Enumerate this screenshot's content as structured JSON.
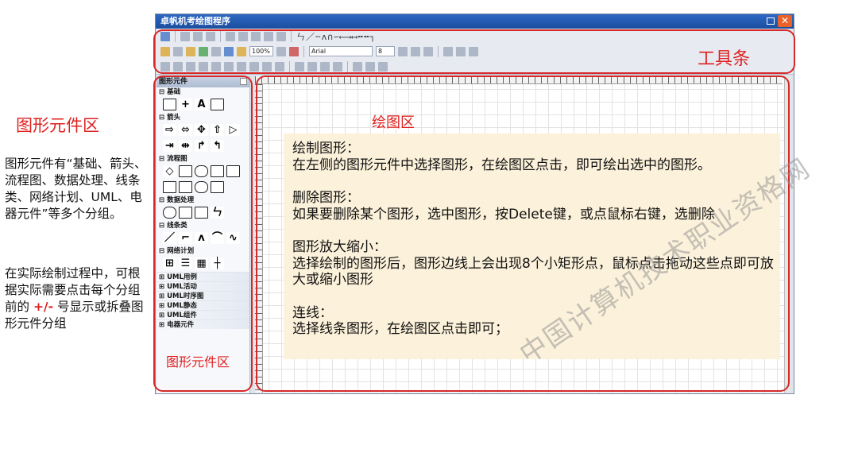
{
  "left_panel": {
    "title": "图形元件区",
    "desc1": "图形元件有“基础、箭头、流程图、数据处理、线条类、网络计划、UML、电器元件”等多个分组。",
    "desc2_prefix": "在实际绘制过程中，可根据实际需要点击每个分组前的 ",
    "desc2_highlight": "+/-",
    "desc2_suffix": " 号显示或拆叠图形元件分组"
  },
  "window": {
    "title": "卓帆机考绘图程序",
    "close_glyph": "✕"
  },
  "toolbar": {
    "zoom": "100%",
    "font_name": "Arial",
    "font_size": "8",
    "line_styles": "ㄣ／╌ʌ∩∽⟵⟶⟷╍╍┐"
  },
  "palette": {
    "header": "图形元件",
    "groups": [
      {
        "label": "⊟ 基础"
      },
      {
        "label": "⊟ 箭头"
      },
      {
        "label": "⊟ 流程图"
      },
      {
        "label": "⊟ 数据处理"
      },
      {
        "label": "⊟ 线条类"
      },
      {
        "label": "⊟ 网络计划"
      },
      {
        "label": "⊞ UML用例"
      },
      {
        "label": "⊞ UML活动"
      },
      {
        "label": "⊞ UML时序图"
      },
      {
        "label": "⊞ UML静态"
      },
      {
        "label": "⊞ UML组件"
      },
      {
        "label": "⊞ 电器元件"
      }
    ]
  },
  "labels": {
    "toolbar": "工具条",
    "draw_area": "绘图区",
    "palette_area": "图形元件区"
  },
  "notes": [
    {
      "title": "绘制图形：",
      "body": "在左侧的图形元件中选择图形，在绘图区点击，即可绘出选中的图形。"
    },
    {
      "title": "删除图形：",
      "body": "如果要删除某个图形，选中图形，按Delete键，或点鼠标右键，选删除"
    },
    {
      "title": "图形放大缩小：",
      "body": "选择绘制的图形后，图形边线上会出现8个小矩形点，鼠标点击拖动这些点即可放大或缩小图形"
    },
    {
      "title": "连线：",
      "body": "选择线条图形，在绘图区点击即可；"
    }
  ],
  "watermark": "中国计算机技术职业资格网"
}
